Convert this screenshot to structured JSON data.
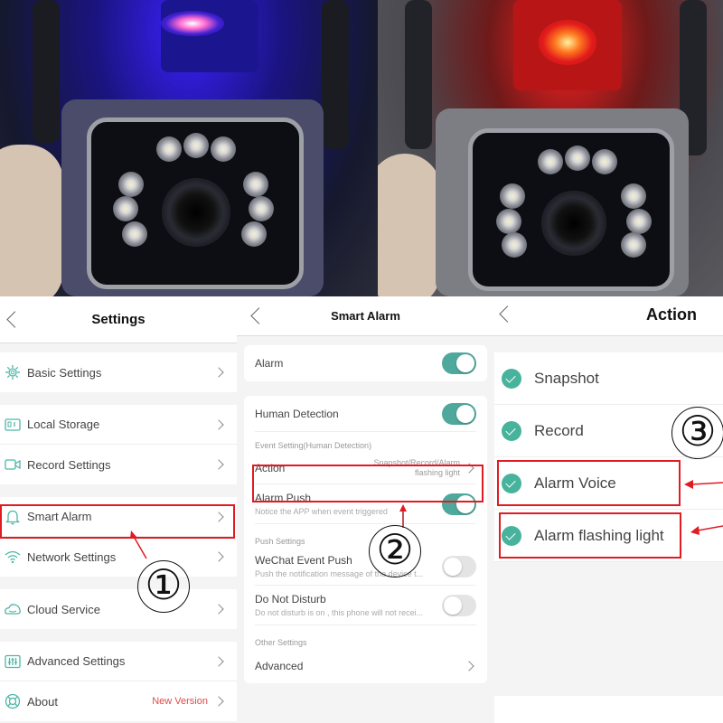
{
  "photos": {
    "left": {
      "description": "Camera with blue/red alarm flashing light",
      "beacon_color": "#3a20ff"
    },
    "right": {
      "description": "Camera with red alarm flashing light",
      "beacon_color": "#ff2020"
    }
  },
  "settings_screen": {
    "title": "Settings",
    "groups": [
      [
        {
          "icon": "gear-icon",
          "label": "Basic Settings"
        }
      ],
      [
        {
          "icon": "sd-card-icon",
          "label": "Local Storage"
        },
        {
          "icon": "video-camera-icon",
          "label": "Record Settings"
        }
      ],
      [
        {
          "icon": "bell-icon",
          "label": "Smart Alarm"
        },
        {
          "icon": "wifi-icon",
          "label": "Network Settings"
        }
      ],
      [
        {
          "icon": "cloud-icon",
          "label": "Cloud Service"
        }
      ],
      [
        {
          "icon": "sliders-icon",
          "label": "Advanced Settings"
        },
        {
          "icon": "lifebuoy-icon",
          "label": "About",
          "extra": "New Version"
        }
      ]
    ]
  },
  "smart_alarm_screen": {
    "title": "Smart Alarm",
    "alarm": {
      "label": "Alarm",
      "on": true
    },
    "human_detection": {
      "label": "Human Detection",
      "on": true
    },
    "event_section": "Event Setting(Human Detection)",
    "action": {
      "label": "Action",
      "value_line1": "Snapshot/Record/Alarm",
      "value_line2": "flashing light"
    },
    "alarm_push": {
      "label": "Alarm Push",
      "sub": "Notice the APP when event triggered",
      "on": true
    },
    "push_section": "Push Settings",
    "wechat_push": {
      "label": "WeChat Event Push",
      "sub": "Push the notification message of the device t...",
      "on": false
    },
    "do_not_disturb": {
      "label": "Do Not Disturb",
      "sub": "Do not disturb is on , this phone will not recei...",
      "on": false
    },
    "other_section": "Other Settings",
    "advanced": {
      "label": "Advanced"
    }
  },
  "action_screen": {
    "title": "Action",
    "items": [
      {
        "label": "Snapshot",
        "checked": true
      },
      {
        "label": "Record",
        "checked": true
      },
      {
        "label": "Alarm Voice",
        "checked": true
      },
      {
        "label": "Alarm flashing light",
        "checked": true
      }
    ]
  },
  "annotations": {
    "step1": "①",
    "step2": "②",
    "step3": "③",
    "highlight_color": "#e01b22"
  },
  "colors": {
    "accent": "#4fa89c",
    "check": "#48b39c",
    "new_version": "#e04a4a"
  }
}
